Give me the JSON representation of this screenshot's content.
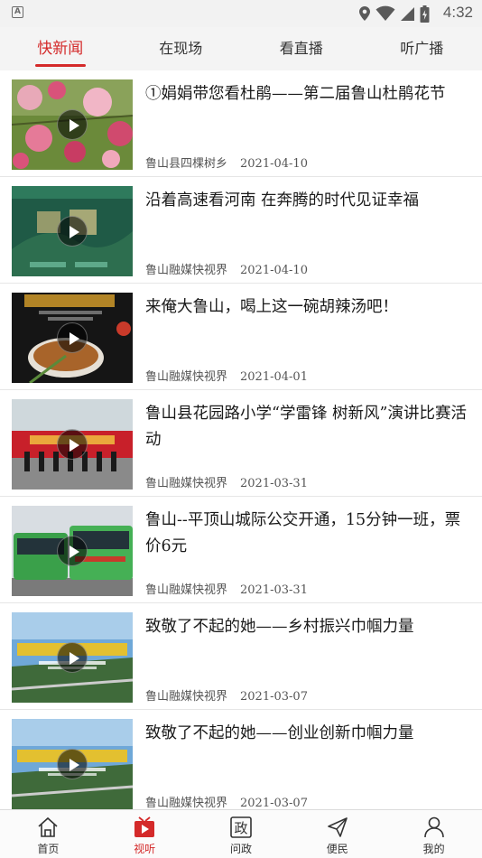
{
  "status_bar": {
    "a_badge": "A",
    "time": "4:32",
    "icons": [
      "location-icon",
      "wifi-icon",
      "signal-icon",
      "battery-icon"
    ]
  },
  "top_tabs": [
    {
      "label": "快新闻",
      "active": true
    },
    {
      "label": "在现场",
      "active": false
    },
    {
      "label": "看直播",
      "active": false
    },
    {
      "label": "听广播",
      "active": false
    }
  ],
  "news": [
    {
      "title": "①娟娟带您看杜鹃——第二届鲁山杜鹃花节",
      "source": "鲁山县四棵树乡",
      "date": "2021-04-10"
    },
    {
      "title": "沿着高速看河南 在奔腾的时代见证幸福",
      "source": "鲁山融媒快视界",
      "date": "2021-04-10"
    },
    {
      "title": "来俺大鲁山，喝上这一碗胡辣汤吧！",
      "source": "鲁山融媒快视界",
      "date": "2021-04-01"
    },
    {
      "title": "鲁山县花园路小学“学雷锋 树新风”演讲比赛活动",
      "source": "鲁山融媒快视界",
      "date": "2021-03-31"
    },
    {
      "title": "鲁山--平顶山城际公交开通，15分钟一班，票价6元",
      "source": "鲁山融媒快视界",
      "date": "2021-03-31"
    },
    {
      "title": "致敬了不起的她——乡村振兴巾帼力量",
      "source": "鲁山融媒快视界",
      "date": "2021-03-07"
    },
    {
      "title": "致敬了不起的她——创业创新巾帼力量",
      "source": "鲁山融媒快视界",
      "date": "2021-03-07"
    }
  ],
  "bottom_nav": [
    {
      "label": "首页",
      "icon": "home-icon",
      "active": false
    },
    {
      "label": "视听",
      "icon": "video-icon",
      "active": true
    },
    {
      "label": "问政",
      "icon": "zheng-icon",
      "active": false
    },
    {
      "label": "便民",
      "icon": "send-icon",
      "active": false
    },
    {
      "label": "我的",
      "icon": "user-icon",
      "active": false
    }
  ],
  "colors": {
    "accent": "#d42a2a",
    "divider": "#e6e6e6",
    "tabbar_bg": "#f4f4f4"
  }
}
